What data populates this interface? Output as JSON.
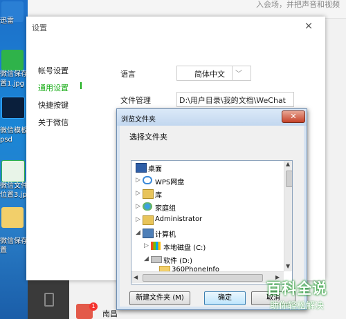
{
  "desktop": {
    "icons": [
      {
        "label": "迅雷"
      },
      {
        "label": "微信保存位"
      },
      {
        "label": "置1.jpg"
      },
      {
        "label": "微信模板."
      },
      {
        "label": "psd"
      },
      {
        "label": "微信文件保"
      },
      {
        "label": "位置3.jpg"
      },
      {
        "label": "微信保存位"
      },
      {
        "label": "置"
      }
    ]
  },
  "background": {
    "top_text": "入会场，并把声音和视频",
    "chat_name": "南昌"
  },
  "settings": {
    "title": "设置",
    "close": "×",
    "nav": [
      {
        "label": "帐号设置"
      },
      {
        "label": "通用设置"
      },
      {
        "label": "快捷按键"
      },
      {
        "label": "关于微信"
      }
    ],
    "language_label": "语言",
    "language_value": "简体中文",
    "file_label": "文件管理",
    "file_path": "D:\\用户目录\\我的文档\\WeChat"
  },
  "dialog": {
    "title": "浏览文件夹",
    "close": "✕",
    "prompt": "选择文件夹",
    "tree": [
      {
        "label": "桌面",
        "arrow": "",
        "icon": "desktop-icon"
      },
      {
        "label": "WPS网盘",
        "arrow": "▷",
        "icon": "cloud-icon"
      },
      {
        "label": "库",
        "arrow": "▷",
        "icon": "library-icon"
      },
      {
        "label": "家庭组",
        "arrow": "▷",
        "icon": "homegroup-icon"
      },
      {
        "label": "Administrator",
        "arrow": "▷",
        "icon": "user-folder-icon"
      },
      {
        "label": "计算机",
        "arrow": "◢",
        "icon": "computer-icon"
      },
      {
        "label": "本地磁盘 (C:)",
        "arrow": "▷",
        "icon": "windows-drive-icon"
      },
      {
        "label": "软件 (D:)",
        "arrow": "◢",
        "icon": "drive-icon"
      },
      {
        "label": "360PhoneInfo",
        "arrow": "",
        "icon": "folder-icon"
      }
    ],
    "new_folder_button": "新建文件夹 (M)",
    "ok_button": "确定",
    "cancel_button": "取消"
  },
  "watermark": {
    "top": "百科全说",
    "bottom": "助你轻松解决"
  },
  "colors": {
    "accent_green": "#1aad19",
    "desktop_blue": "#1d6fc9"
  }
}
